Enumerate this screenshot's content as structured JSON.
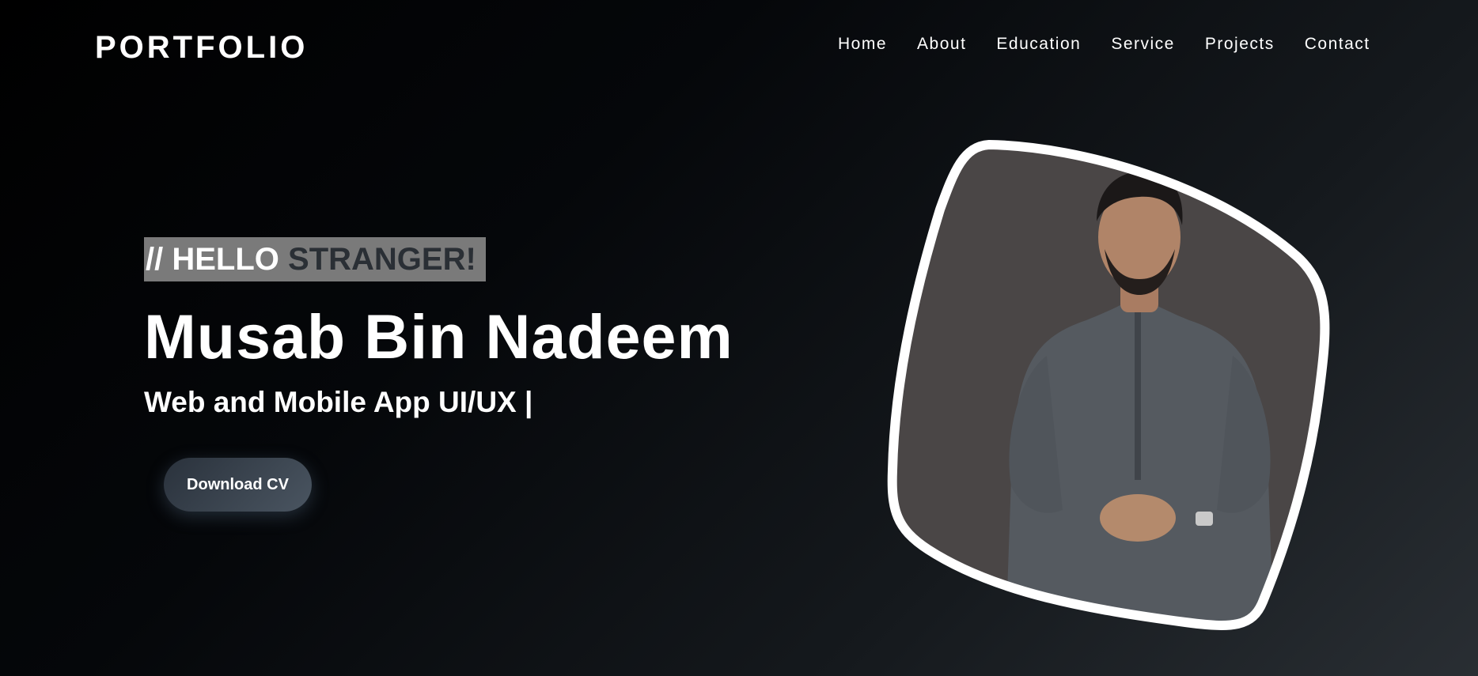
{
  "header": {
    "logo": "PORTFOLIO",
    "nav": [
      "Home",
      "About",
      "Education",
      "Service",
      "Projects",
      "Contact"
    ]
  },
  "hero": {
    "greeting_prefix": "// HELLO",
    "greeting_highlight": "STRANGER!",
    "name": "Musab Bin Nadeem",
    "subtitle": "Web and Mobile App UI/UX |",
    "cta_label": "Download CV"
  },
  "colors": {
    "greeting_bg": "#7a7a7a",
    "highlight_text": "#2a2f35",
    "photo_bg": "#4a4646",
    "frame": "#ffffff"
  },
  "icons": [
    "profile-photo"
  ]
}
